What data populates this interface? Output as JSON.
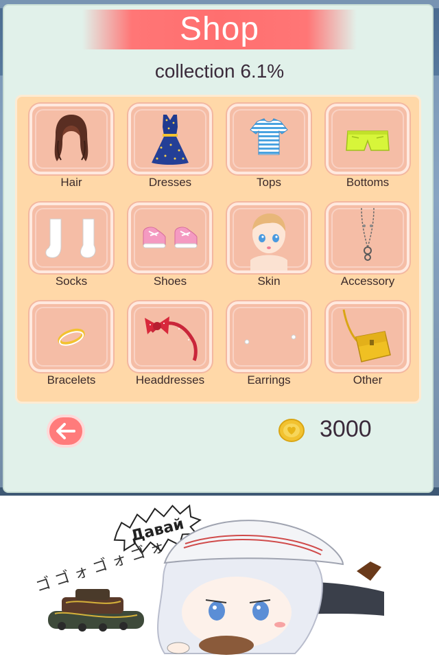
{
  "shop": {
    "title": "Shop",
    "collection": "collection 6.1%",
    "coins": "3000",
    "categories": [
      {
        "label": "Hair",
        "icon": "hair-icon"
      },
      {
        "label": "Dresses",
        "icon": "dress-icon"
      },
      {
        "label": "Tops",
        "icon": "striped-top-icon"
      },
      {
        "label": "Bottoms",
        "icon": "shorts-icon"
      },
      {
        "label": "Socks",
        "icon": "socks-icon"
      },
      {
        "label": "Shoes",
        "icon": "sneakers-icon"
      },
      {
        "label": "Skin",
        "icon": "doll-face-icon"
      },
      {
        "label": "Accessory",
        "icon": "necklace-icon"
      },
      {
        "label": "Bracelets",
        "icon": "bracelet-icon"
      },
      {
        "label": "Headdresses",
        "icon": "bow-headband-icon"
      },
      {
        "label": "Earrings",
        "icon": "earrings-icon"
      },
      {
        "label": "Other",
        "icon": "handbag-icon"
      }
    ]
  },
  "colors": {
    "banner": "#ff6f6f",
    "panel_bg": "#e1f1ea",
    "grid_bg": "#ffd8a8",
    "tile_bg": "#f5bda6",
    "back_button": "#ff7b7b",
    "coin": "#f2c230"
  },
  "comic": {
    "shout": "Давай",
    "sfx": "ゴ ゴ ォ ゴ ォ ゴ ォ"
  }
}
